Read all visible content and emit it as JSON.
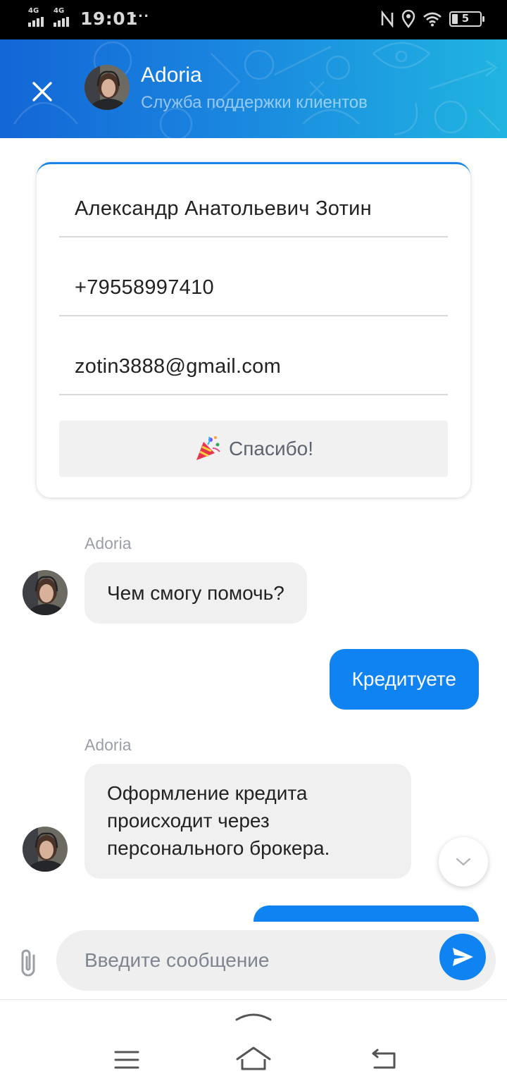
{
  "status_bar": {
    "sim1_label": "4G",
    "sim2_label": "4G",
    "time": "19:01",
    "more": "···",
    "battery_level": "5",
    "icons": [
      "nfc-icon",
      "location-icon",
      "wifi-icon",
      "battery-icon"
    ]
  },
  "header": {
    "title": "Adoria",
    "subtitle": "Служба поддержки клиентов",
    "close_icon": "close-icon",
    "accent_gradient": [
      "#1366d6",
      "#20b4e0"
    ]
  },
  "contact_form": {
    "name": "Александр Анатольевич Зотин",
    "phone": "+79558997410",
    "email": "zotin3888@gmail.com",
    "submit_label": "Спасибо!",
    "submit_icon": "party-popper-icon"
  },
  "messages": [
    {
      "direction": "incoming",
      "sender": "Adoria",
      "text": "Чем смогу помочь?"
    },
    {
      "direction": "outgoing",
      "text": "Кредитуете"
    },
    {
      "direction": "incoming",
      "sender": "Adoria",
      "lines": [
        "Оформление кредита",
        "происходит через",
        "персонального брокера."
      ]
    }
  ],
  "composer": {
    "placeholder": "Введите сообщение",
    "attach_icon": "paperclip-icon",
    "send_icon": "send-icon"
  },
  "colors": {
    "accent": "#0f83f1",
    "incoming_bubble": "#f0f0f0"
  },
  "nav_bar": {
    "buttons": [
      "menu-icon",
      "home-icon",
      "back-icon"
    ]
  }
}
